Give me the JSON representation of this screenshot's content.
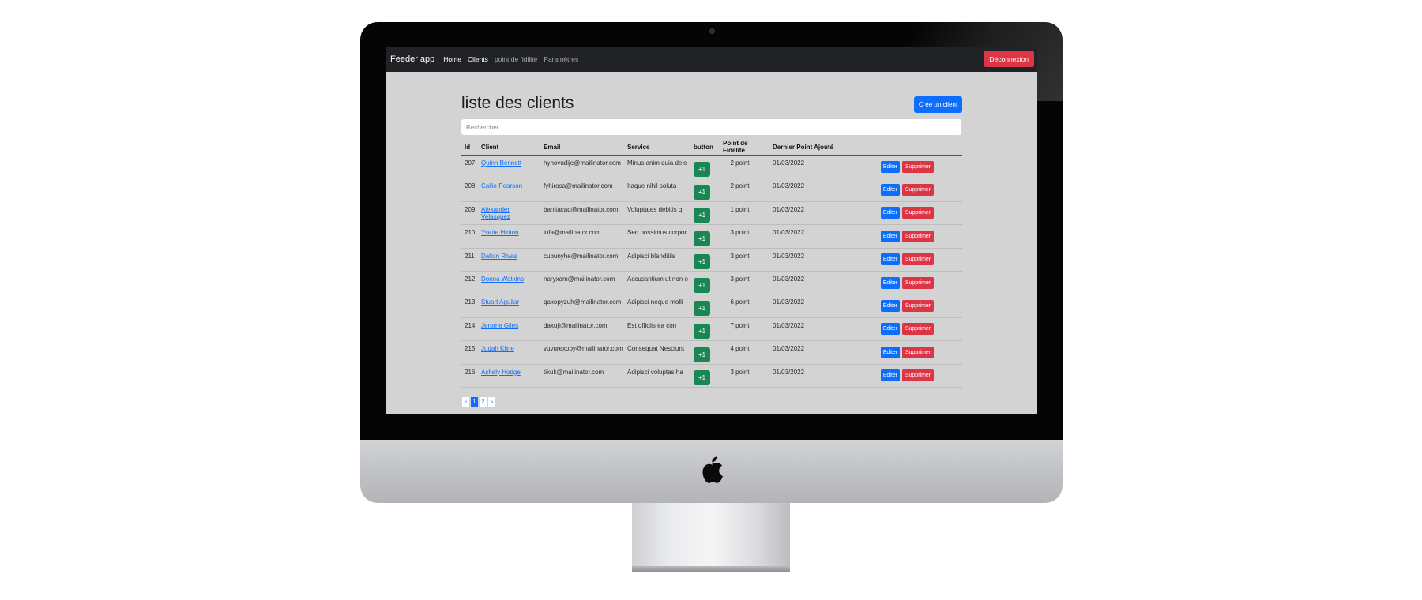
{
  "navbar": {
    "brand": "Feeder app",
    "links": [
      "Home",
      "Clients",
      "point de fidilité",
      "Paramètres"
    ],
    "logout_label": "Déconnexion"
  },
  "page": {
    "title": "liste des clients",
    "create_label": "Crée un client",
    "search_placeholder": "Rechercher..."
  },
  "table": {
    "headers": [
      "Id",
      "Client",
      "Email",
      "Service",
      "button",
      "Point de Fidelité",
      "Dernier Point Ajouté",
      ""
    ],
    "plus_label": "+1",
    "edit_label": "Editer",
    "delete_label": "Supprimer",
    "rows": [
      {
        "id": "207",
        "client": "Quinn Bennett",
        "email": "hynovudije@mailinator.com",
        "service": "Minus anim quia dele",
        "points": "2 point",
        "date": "01/03/2022"
      },
      {
        "id": "208",
        "client": "Callie Pearson",
        "email": "fyhirosa@mailinator.com",
        "service": "Itaque nihil soluta",
        "points": "2 point",
        "date": "01/03/2022"
      },
      {
        "id": "209",
        "client": "Alexander Velasquez",
        "email": "banitacaq@mailinator.com",
        "service": "Voluptates debitis q",
        "points": "1 point",
        "date": "01/03/2022"
      },
      {
        "id": "210",
        "client": "Yvette Hinton",
        "email": "lufa@mailinator.com",
        "service": "Sed possimus corpor",
        "points": "3 point",
        "date": "01/03/2022"
      },
      {
        "id": "211",
        "client": "Dalton Rivas",
        "email": "cubunyhe@mailinator.com",
        "service": "Adipisci blanditiis",
        "points": "3 point",
        "date": "01/03/2022"
      },
      {
        "id": "212",
        "client": "Donna Watkins",
        "email": "naryxam@mailinator.com",
        "service": "Accusantium ut non o",
        "points": "3 point",
        "date": "01/03/2022"
      },
      {
        "id": "213",
        "client": "Stuart Aguilar",
        "email": "qakopyzuh@mailinator.com",
        "service": "Adipisci neque molli",
        "points": "6 point",
        "date": "01/03/2022"
      },
      {
        "id": "214",
        "client": "Jerome Giles",
        "email": "dakuji@mailinator.com",
        "service": "Est officiis ea con",
        "points": "7 point",
        "date": "01/03/2022"
      },
      {
        "id": "215",
        "client": "Judah Kline",
        "email": "vuvurexoby@mailinator.com",
        "service": "Consequat Nesciunt",
        "points": "4 point",
        "date": "01/03/2022"
      },
      {
        "id": "216",
        "client": "Ashely Hodge",
        "email": "tikuk@mailinator.com",
        "service": "Adipisci voluptas ha",
        "points": "3 point",
        "date": "01/03/2022"
      }
    ]
  },
  "pagination": {
    "prev": "«",
    "pages": [
      "1",
      "2"
    ],
    "next": "»",
    "active_page": "1"
  },
  "colors": {
    "navbar": "#202225",
    "primary": "#0d6efd",
    "danger": "#dc3545",
    "success": "#198754",
    "page_background": "#d3d3d4"
  }
}
